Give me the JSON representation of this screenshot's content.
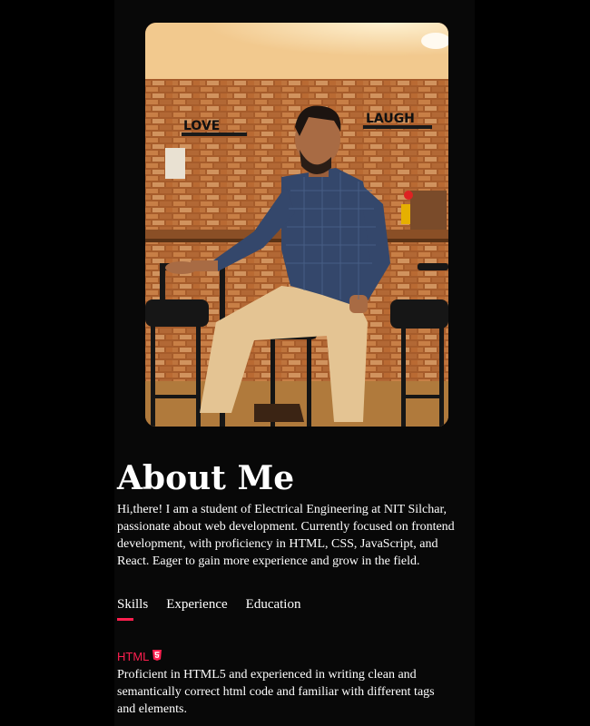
{
  "about": {
    "title": "About Me",
    "description": "Hi,there! I am a student of Electrical Engineering at NIT Silchar, passionate about web development. Currently focused on frontend development, with proficiency in HTML, CSS, JavaScript, and React. Eager to gain more experience and grow in the field."
  },
  "photo": {
    "sign_left": "LOVE",
    "sign_right": "LAUGH"
  },
  "tabs": [
    {
      "label": "Skills",
      "active": true
    },
    {
      "label": "Experience",
      "active": false
    },
    {
      "label": "Education",
      "active": false
    }
  ],
  "skills": [
    {
      "name": "HTML",
      "icon": "html5-icon",
      "description": "Proficient in HTML5 and experienced in writing clean and semantically correct html code and familiar with different tags and elements."
    }
  ],
  "colors": {
    "accent": "#ff1f4f",
    "background": "#000000",
    "panel": "#080808",
    "text": "#ffffff"
  }
}
